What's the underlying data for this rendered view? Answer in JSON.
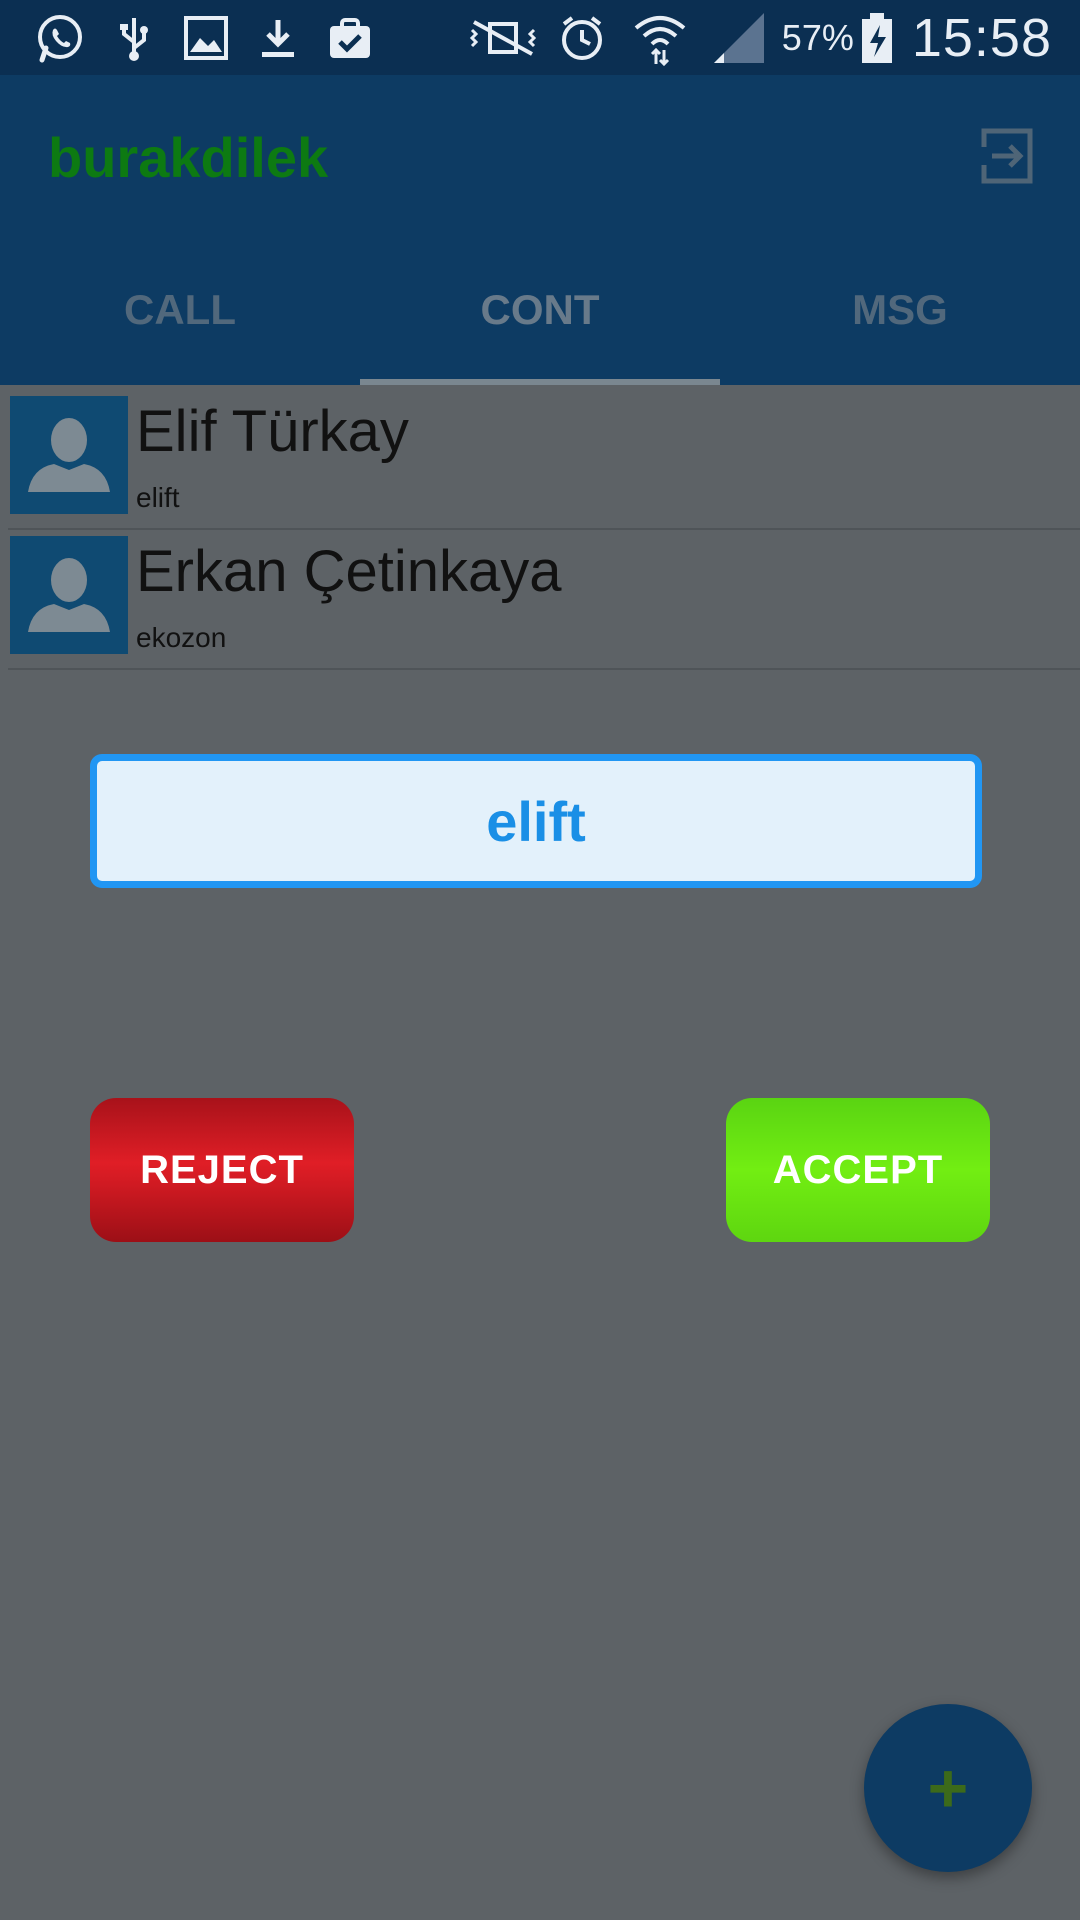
{
  "status_bar": {
    "battery": "57%",
    "time": "15:58",
    "icons": [
      "whatsapp-icon",
      "usb-icon",
      "image-icon",
      "download-icon",
      "clipboard-check-icon",
      "mute-icon",
      "alarm-icon",
      "wifi-icon",
      "signal-icon",
      "battery-charging-icon"
    ]
  },
  "app_bar": {
    "title": "burakdilek",
    "title_color": "#0d7a12",
    "background": "#0d3b63"
  },
  "tabs": [
    {
      "label": "CALL",
      "active": false
    },
    {
      "label": "CONT",
      "active": true
    },
    {
      "label": "MSG",
      "active": false
    }
  ],
  "contacts": [
    {
      "name": "Elif Türkay",
      "username": "elift"
    },
    {
      "name": "Erkan Çetinkaya",
      "username": "ekozon"
    }
  ],
  "dialog": {
    "caller": "elift",
    "reject_label": "REJECT",
    "accept_label": "ACCEPT"
  },
  "fab": {
    "label": "+"
  }
}
